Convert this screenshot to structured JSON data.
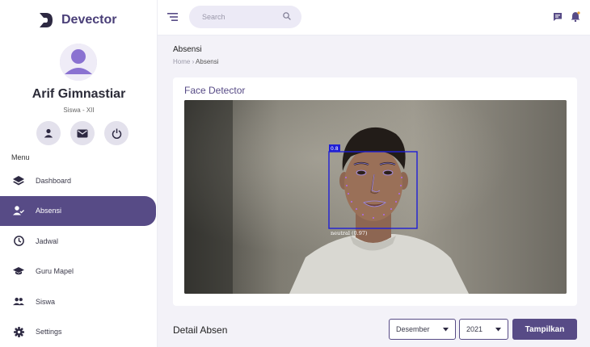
{
  "brand": {
    "name": "Devector"
  },
  "user": {
    "name": "Arif Gimnastiar",
    "role": "Siswa - XII"
  },
  "quick_actions": [
    "user-icon",
    "mail-icon",
    "power-icon"
  ],
  "sidebar": {
    "menu_label": "Menu",
    "items": [
      {
        "label": "Dashboard",
        "icon": "dashboard-icon"
      },
      {
        "label": "Absensi",
        "icon": "user-check-icon",
        "active": true
      },
      {
        "label": "Jadwal",
        "icon": "clock-icon"
      },
      {
        "label": "Guru Mapel",
        "icon": "graduation-cap-icon"
      },
      {
        "label": "Siswa",
        "icon": "users-icon"
      },
      {
        "label": "Settings",
        "icon": "gear-icon"
      }
    ]
  },
  "header": {
    "search": {
      "placeholder": "Search"
    }
  },
  "page": {
    "title": "Absensi",
    "breadcrumb": {
      "home": "Home",
      "separator": "›",
      "current": "Absensi"
    }
  },
  "face_card": {
    "title": "Face Detector",
    "detection": {
      "score": "0.8",
      "expression": "neutral (0.97)"
    }
  },
  "detail": {
    "title": "Detail Absen",
    "month": "Desember",
    "year": "2021",
    "button": "Tampilkan"
  },
  "colors": {
    "accent": "#574b86",
    "background": "#f3f2f8",
    "detection_box": "#1f1fd6"
  }
}
